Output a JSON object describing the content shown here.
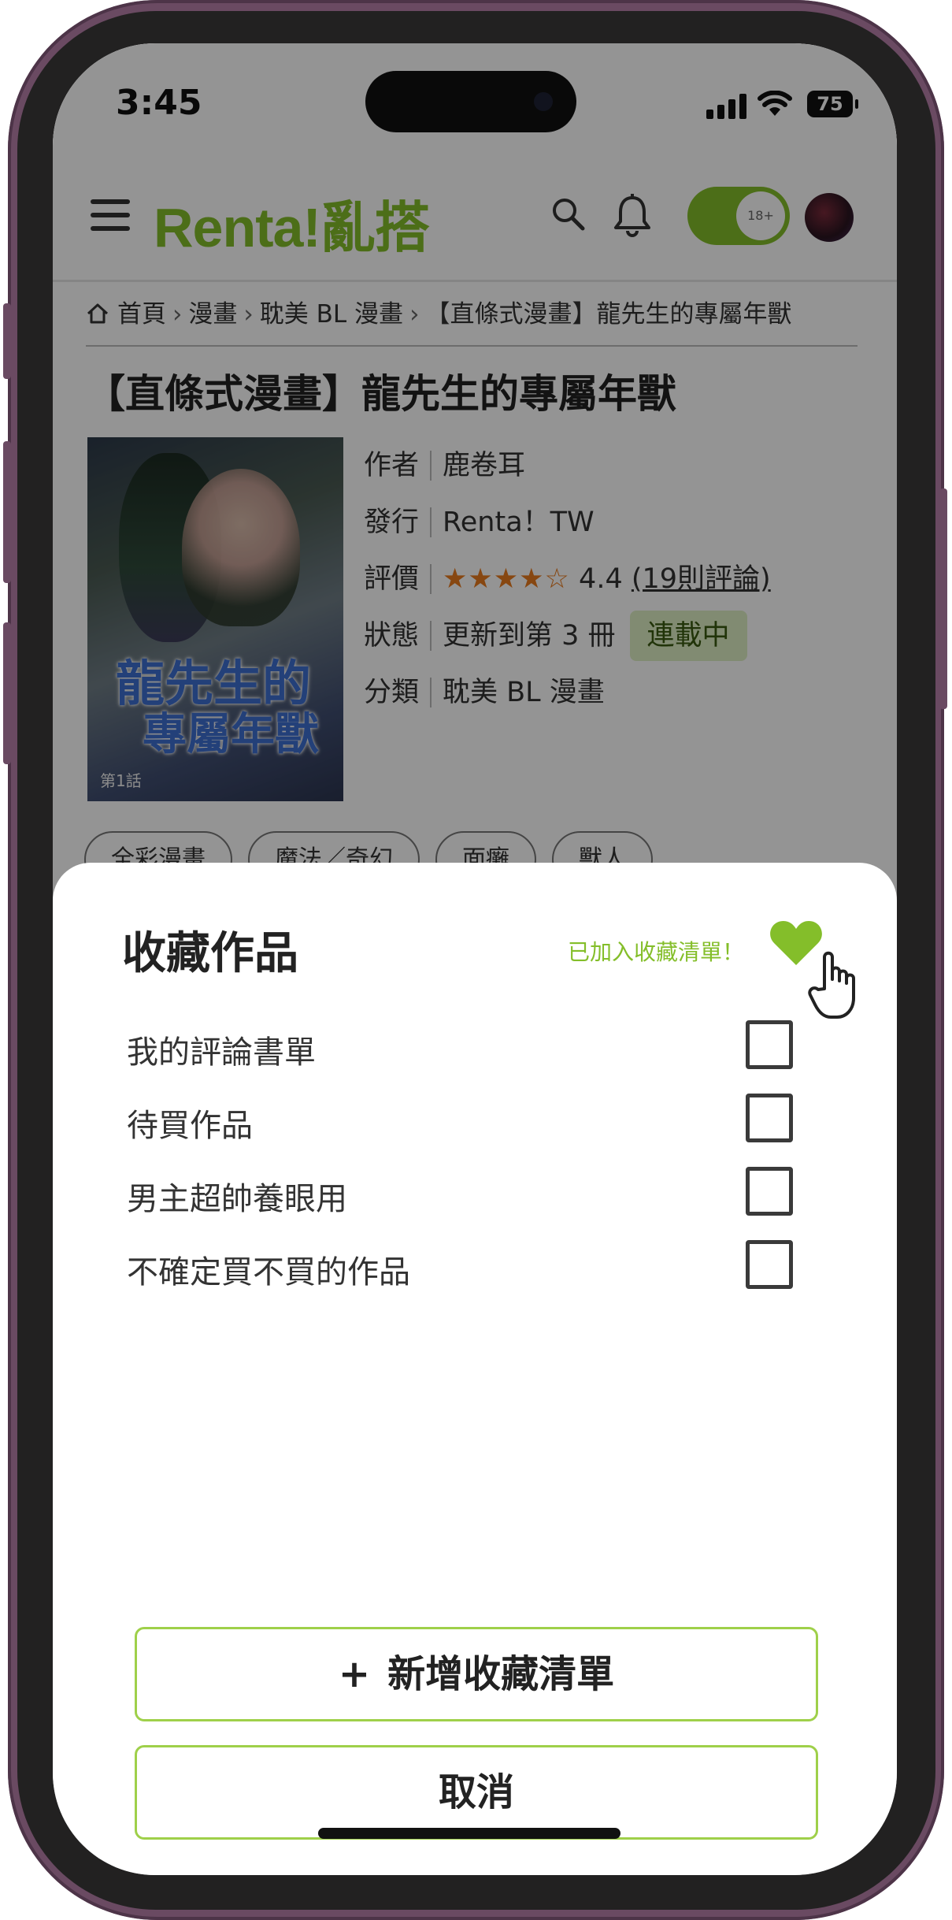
{
  "status_bar": {
    "time": "3:45",
    "battery": "75"
  },
  "header": {
    "logo": "Renta!亂搭",
    "age_toggle": "18+"
  },
  "breadcrumb": [
    "首頁",
    "漫畫",
    "耽美 BL 漫畫",
    "【直條式漫畫】龍先生的專屬年獸"
  ],
  "product": {
    "title": "【直條式漫畫】龍先生的專屬年獸",
    "cover": {
      "title_line1": "龍先生的",
      "title_line2": "專屬年獸",
      "volume": "第1話"
    },
    "info": {
      "author_label": "作者",
      "author": "鹿卷耳",
      "publisher_label": "發行",
      "publisher": "Renta！TW",
      "rating_label": "評價",
      "rating_stars": "★★★★☆",
      "rating_value": "4.4",
      "rating_reviews": "(19則評論)",
      "rating_score": 4.4,
      "status_label": "狀態",
      "status": "更新到第 3 冊",
      "status_badge": "連載中",
      "category_label": "分類",
      "category": "耽美 BL 漫畫"
    },
    "tags": [
      "全彩漫畫",
      "魔法／奇幻",
      "面癱",
      "獸人"
    ]
  },
  "favorite_sheet": {
    "title": "收藏作品",
    "added_message": "已加入收藏清單！",
    "lists": [
      {
        "label": "我的評論書單",
        "checked": false
      },
      {
        "label": "待買作品",
        "checked": false
      },
      {
        "label": "男主超帥養眼用",
        "checked": false
      },
      {
        "label": "不確定買不買的作品",
        "checked": false
      }
    ],
    "add_button": "新增收藏清單",
    "add_icon": "+",
    "cancel_button": "取消"
  },
  "colors": {
    "brand": "#84be2a",
    "star": "#e87a1e",
    "frame": "#6a4a62"
  }
}
